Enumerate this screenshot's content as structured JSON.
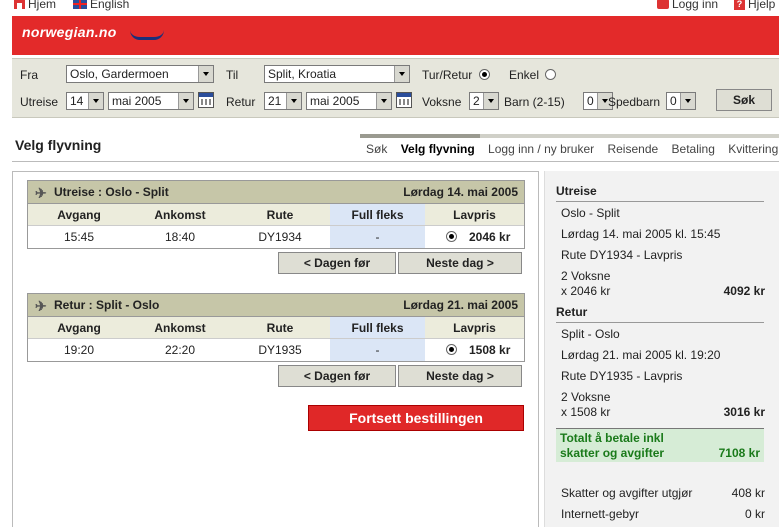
{
  "topbar": {
    "home": "Hjem",
    "english": "English",
    "login": "Logg inn",
    "help": "Hjelp"
  },
  "brand": {
    "logo_text": "norwegian.no",
    "accent": "#e32a2a",
    "navy": "#1a2f7a"
  },
  "search": {
    "fra_label": "Fra",
    "fra_value": "Oslo, Gardermoen",
    "til_label": "Til",
    "til_value": "Split, Kroatia",
    "turretur_label": "Tur/Retur",
    "enkel_label": "Enkel",
    "utreise_label": "Utreise",
    "utreise_day": "14",
    "utreise_month": "mai 2005",
    "retur_label": "Retur",
    "retur_day": "21",
    "retur_month": "mai 2005",
    "voksne_label": "Voksne",
    "voksne_value": "2",
    "barn_label": "Barn (2-15)",
    "barn_value": "0",
    "spedbarn_label": "Spedbarn",
    "spedbarn_value": "0",
    "sok_button": "Søk"
  },
  "page": {
    "title": "Velg flyvning"
  },
  "steps": [
    "Søk",
    "Velg flyvning",
    "Logg inn / ny bruker",
    "Reisende",
    "Betaling",
    "Kvittering"
  ],
  "columns": [
    "Avgang",
    "Ankomst",
    "Rute",
    "Full fleks",
    "Lavpris"
  ],
  "outbound": {
    "header": "Utreise : Oslo - Split",
    "date": "Lørdag 14. mai 2005",
    "avgang": "15:45",
    "ankomst": "18:40",
    "rute": "DY1934",
    "full_fleks": "-",
    "lavpris": "2046 kr",
    "prev": "< Dagen før",
    "next": "Neste dag >"
  },
  "inbound": {
    "header": "Retur : Split - Oslo",
    "date": "Lørdag 21. mai 2005",
    "avgang": "19:20",
    "ankomst": "22:20",
    "rute": "DY1935",
    "full_fleks": "-",
    "lavpris": "1508 kr",
    "prev": "< Dagen før",
    "next": "Neste dag >"
  },
  "continue_button": "Fortsett bestillingen",
  "summary": {
    "utreise_title": "Utreise",
    "utreise_route": "Oslo - Split",
    "utreise_time": "Lørdag 14. mai 2005 kl. 15:45",
    "utreise_rute": "Rute DY1934 - Lavpris",
    "utreise_pax": "2 Voksne",
    "utreise_calc": "x 2046 kr",
    "utreise_sum": "4092 kr",
    "retur_title": "Retur",
    "retur_route": "Split - Oslo",
    "retur_time": "Lørdag 21. mai 2005 kl. 19:20",
    "retur_rute": "Rute DY1935 - Lavpris",
    "retur_pax": "2 Voksne",
    "retur_calc": "x 1508 kr",
    "retur_sum": "3016 kr",
    "total_label_1": "Totalt å betale inkl",
    "total_label_2": "skatter og avgifter",
    "total_value": "7108 kr",
    "tax_label": "Skatter og avgifter utgjør",
    "tax_value": "408 kr",
    "fee_label": "Internett-gebyr",
    "fee_value": "0 kr"
  }
}
